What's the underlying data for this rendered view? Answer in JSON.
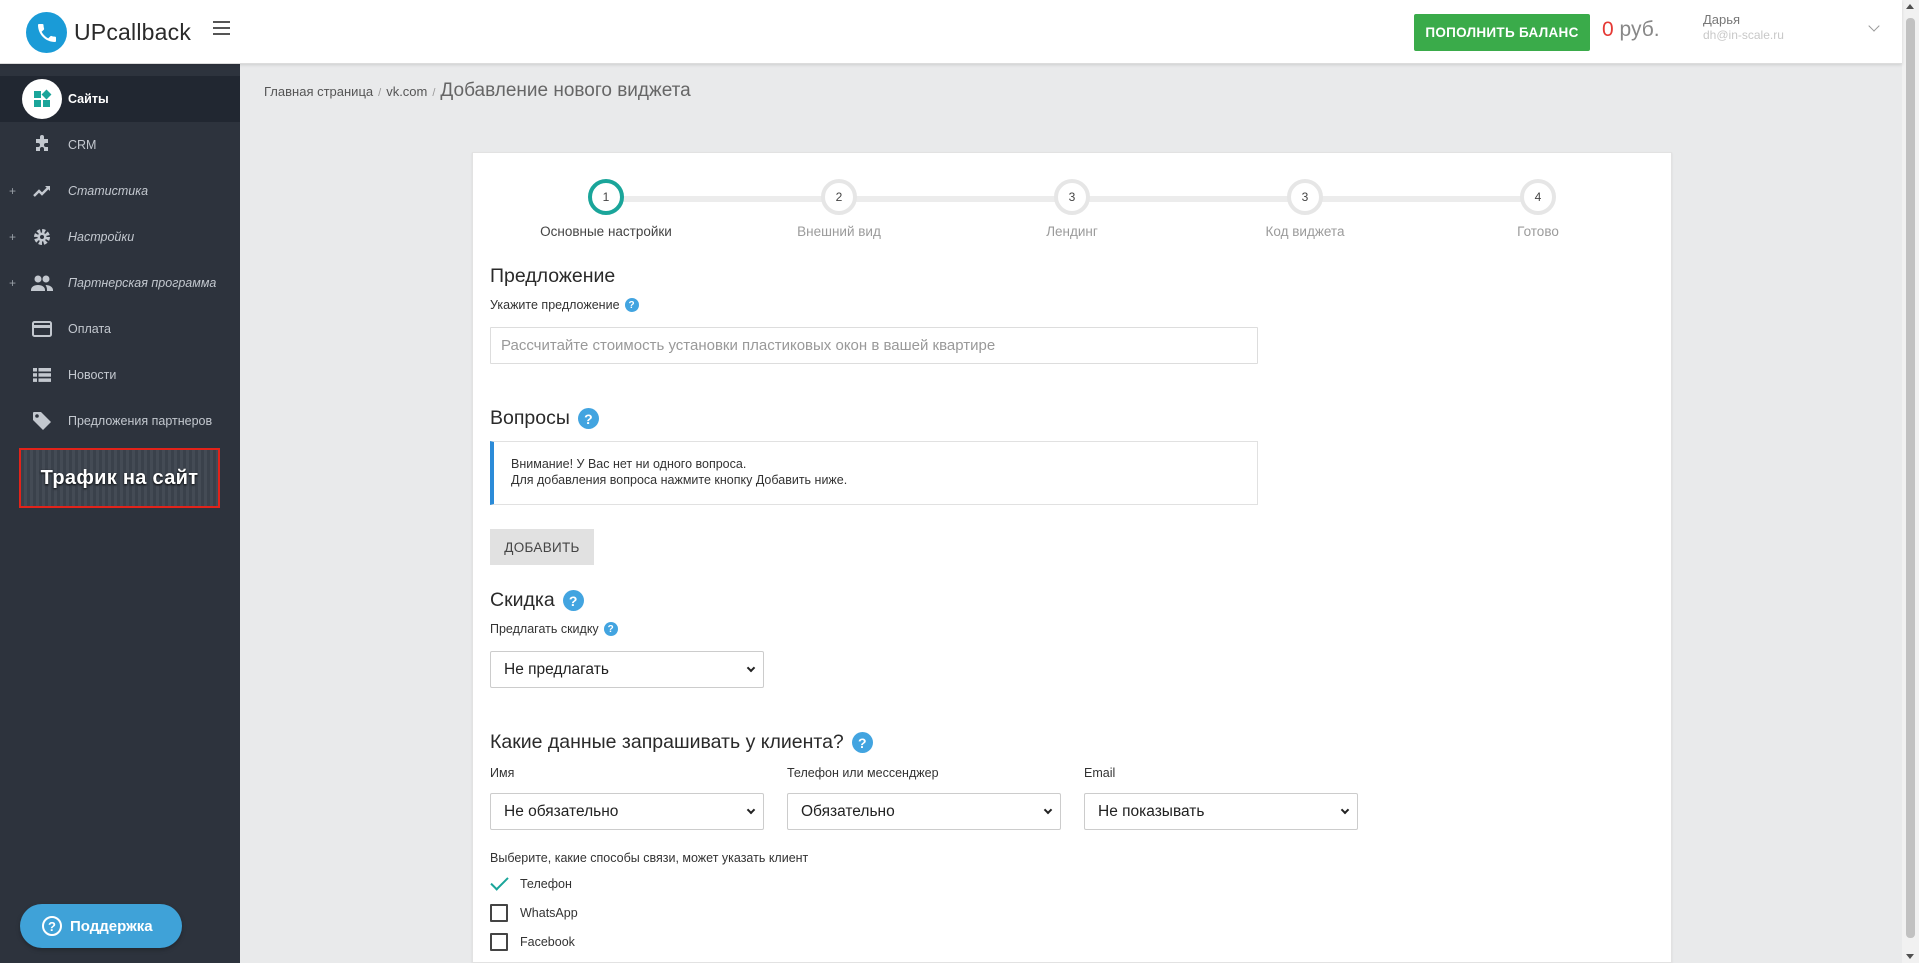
{
  "header": {
    "logo_text": "UPcallback",
    "topup_label": "ПОПОЛНИТЬ БАЛАНС",
    "balance_amount": "0",
    "balance_currency": "руб.",
    "user_name": "Дарья",
    "user_email": "dh@in-scale.ru"
  },
  "sidebar": {
    "items": [
      {
        "label": "Сайты",
        "icon": "sites-icon",
        "active": true
      },
      {
        "label": "CRM",
        "icon": "puzzle-icon"
      },
      {
        "label": "Статистика",
        "icon": "trending-icon",
        "expandable": true
      },
      {
        "label": "Настройки",
        "icon": "gear-icon",
        "expandable": true
      },
      {
        "label": "Партнерская программа",
        "icon": "people-icon",
        "expandable": true
      },
      {
        "label": "Оплата",
        "icon": "card-icon"
      },
      {
        "label": "Новости",
        "icon": "list-icon"
      },
      {
        "label": "Предложения партнеров",
        "icon": "tag-icon"
      }
    ],
    "expand_symbol": "+",
    "banner_text": "Трафик на сайт",
    "support_label": "Поддержка"
  },
  "breadcrumb": {
    "home": "Главная страница",
    "site": "vk.com",
    "current": "Добавление нового виджета",
    "separator": "/"
  },
  "steps": [
    {
      "number": "1",
      "label": "Основные настройки",
      "current": true
    },
    {
      "number": "2",
      "label": "Внешний вид"
    },
    {
      "number": "3",
      "label": "Лендинг"
    },
    {
      "number": "3",
      "label": "Код виджета"
    },
    {
      "number": "4",
      "label": "Готово"
    }
  ],
  "offer": {
    "title": "Предложение",
    "field_label": "Укажите предложение",
    "placeholder": "Рассчитайте стоимость установки пластиковых окон в вашей квартире"
  },
  "questions": {
    "title": "Вопросы",
    "alert_line1": "Внимание! У Вас нет ни одного вопроса.",
    "alert_line2": "Для добавления вопроса нажмите кнопку Добавить ниже.",
    "add_label": "ДОБАВИТЬ"
  },
  "discount": {
    "title": "Скидка",
    "field_label": "Предлагать скидку",
    "selected": "Не предлагать"
  },
  "client_data": {
    "title": "Какие данные запрашивать у клиента?",
    "name_label": "Имя",
    "name_selected": "Не обязательно",
    "phone_label": "Телефон или мессенджер",
    "phone_selected": "Обязательно",
    "email_label": "Email",
    "email_selected": "Не показывать",
    "contacts_label": "Выберите, какие способы связи, может указать клиент",
    "contacts": [
      {
        "label": "Телефон",
        "checked": true
      },
      {
        "label": "WhatsApp",
        "checked": false
      },
      {
        "label": "Facebook",
        "checked": false
      }
    ]
  },
  "help_glyph": "?",
  "colors": {
    "sidebar_bg": "#2d333d",
    "topup_green": "#3aab4a",
    "balance_red": "#e53935",
    "step_accent": "#1aa59a",
    "help_blue": "#42a4e0"
  }
}
